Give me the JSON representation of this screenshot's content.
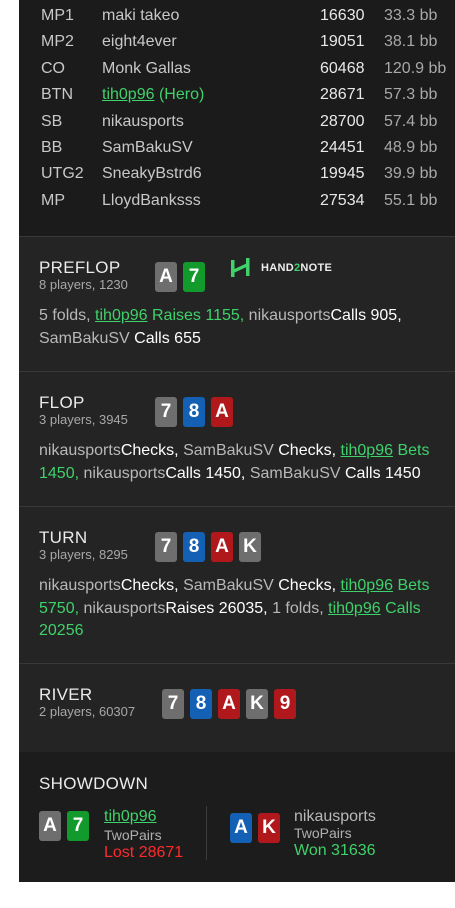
{
  "players": [
    {
      "pos": "MP1",
      "name": "maki takeo",
      "stack": "16630",
      "bb": "33.3 bb"
    },
    {
      "pos": "MP2",
      "name": "eight4ever",
      "stack": "19051",
      "bb": "38.1 bb"
    },
    {
      "pos": "CO",
      "name": "Monk Gallas",
      "stack": "60468",
      "bb": "120.9 bb"
    },
    {
      "pos": "BTN",
      "name": "tih0p96",
      "hero_tag": "(Hero)",
      "stack": "28671",
      "bb": "57.3 bb"
    },
    {
      "pos": "SB",
      "name": "nikausports",
      "stack": "28700",
      "bb": "57.4 bb"
    },
    {
      "pos": "BB",
      "name": "SamBakuSV",
      "stack": "24451",
      "bb": "48.9 bb"
    },
    {
      "pos": "UTG2",
      "name": "SneakyBstrd6",
      "stack": "19945",
      "bb": "39.9 bb"
    },
    {
      "pos": "MP",
      "name": "LloydBanksss",
      "stack": "27534",
      "bb": "55.1 bb"
    }
  ],
  "logo": {
    "pre": "HAND",
    "two": "2",
    "post": "NOTE"
  },
  "preflop": {
    "title": "PREFLOP",
    "sub": "8 players, 1230",
    "cards": [
      {
        "rank": "A",
        "color": "#6e6e6e"
      },
      {
        "rank": "7",
        "color": "#139a2c"
      }
    ],
    "a": {
      "folds": "5 folds,",
      "hero": "tih0p96",
      "raises": "Raises",
      "raise_amt": "1155,",
      "p1": "nikausports",
      "calls1": "Calls 905,",
      "p2": "SamBakuSV",
      "calls2": "Calls 655"
    }
  },
  "flop": {
    "title": "FLOP",
    "sub": "3 players, 3945",
    "cards": [
      {
        "rank": "7",
        "color": "#6e6e6e"
      },
      {
        "rank": "8",
        "color": "#1460b4"
      },
      {
        "rank": "A",
        "color": "#b0181c"
      }
    ],
    "a": {
      "p1": "nikausports",
      "checks1": "Checks,",
      "p2": "SamBakuSV",
      "checks2": "Checks,",
      "hero": "tih0p96",
      "bets": "Bets",
      "bet_amt": "1450,",
      "p3": "nikausports",
      "calls1": "Calls 1450,",
      "p4": "SamBakuSV",
      "calls2": "Calls 1450"
    }
  },
  "turn": {
    "title": "TURN",
    "sub": "3 players, 8295",
    "cards": [
      {
        "rank": "7",
        "color": "#6e6e6e"
      },
      {
        "rank": "8",
        "color": "#1460b4"
      },
      {
        "rank": "A",
        "color": "#b0181c"
      },
      {
        "rank": "K",
        "color": "#6e6e6e"
      }
    ],
    "a": {
      "p1": "nikausports",
      "checks1": "Checks,",
      "p2": "SamBakuSV",
      "checks2": "Checks,",
      "hero": "tih0p96",
      "bets": "Bets",
      "bet_amt": "5750,",
      "p3": "nikausports",
      "raises": "Raises",
      "raise_amt": "26035,",
      "folds": "1 folds,",
      "hero2": "tih0p96",
      "calls": "Calls",
      "call_amt": "20256"
    }
  },
  "river": {
    "title": "RIVER",
    "sub": "2 players, 60307",
    "cards": [
      {
        "rank": "7",
        "color": "#6e6e6e"
      },
      {
        "rank": "8",
        "color": "#1460b4"
      },
      {
        "rank": "A",
        "color": "#b0181c"
      },
      {
        "rank": "K",
        "color": "#6e6e6e"
      },
      {
        "rank": "9",
        "color": "#b0181c"
      }
    ]
  },
  "showdown": {
    "title": "SHOWDOWN",
    "left": {
      "name": "tih0p96",
      "hand": "TwoPairs",
      "result": "Lost 28671",
      "cards": [
        {
          "rank": "A",
          "color": "#6e6e6e"
        },
        {
          "rank": "7",
          "color": "#139a2c"
        }
      ]
    },
    "right": {
      "name": "nikausports",
      "hand": "TwoPairs",
      "result": "Won 31636",
      "cards": [
        {
          "rank": "A",
          "color": "#1460b4"
        },
        {
          "rank": "K",
          "color": "#b0181c"
        }
      ]
    }
  },
  "colors": {
    "hero": "#3fd16a",
    "lost": "#ff2a2a",
    "won": "#3fd16a",
    "panel": "#242424"
  }
}
